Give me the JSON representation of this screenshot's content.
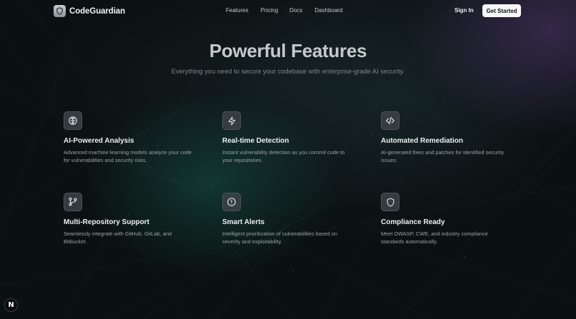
{
  "brand": {
    "name": "CodeGuardian",
    "icon": "shield-icon"
  },
  "nav": {
    "links": [
      "Features",
      "Pricing",
      "Docs",
      "Dashboard"
    ],
    "signin": "Sign In",
    "cta": "Get Started"
  },
  "hero": {
    "title": "Powerful Features",
    "subtitle": "Everything you need to secure your codebase with enterprise-grade AI security."
  },
  "features": [
    {
      "icon": "brain-icon",
      "title": "AI-Powered Analysis",
      "desc": "Advanced machine learning models analyze your code for vulnerabilities and security risks."
    },
    {
      "icon": "lightning-icon",
      "title": "Real-time Detection",
      "desc": "Instant vulnerability detection as you commit code to your repositories."
    },
    {
      "icon": "code-icon",
      "title": "Automated Remediation",
      "desc": "AI-generated fixes and patches for identified security issues."
    },
    {
      "icon": "git-branch-icon",
      "title": "Multi-Repository Support",
      "desc": "Seamlessly integrate with GitHub, GitLab, and Bitbucket."
    },
    {
      "icon": "alert-circle-icon",
      "title": "Smart Alerts",
      "desc": "Intelligent prioritization of vulnerabilities based on severity and exploitability."
    },
    {
      "icon": "shield-icon",
      "title": "Compliance Ready",
      "desc": "Meet OWASP, CWE, and industry compliance standards automatically."
    }
  ],
  "dev_badge": {
    "label": "N"
  },
  "colors": {
    "background": "#0b1012",
    "cta_bg": "#f6f7f8",
    "teal_glow": "#1a735f",
    "purple_glow": "#553c73"
  }
}
